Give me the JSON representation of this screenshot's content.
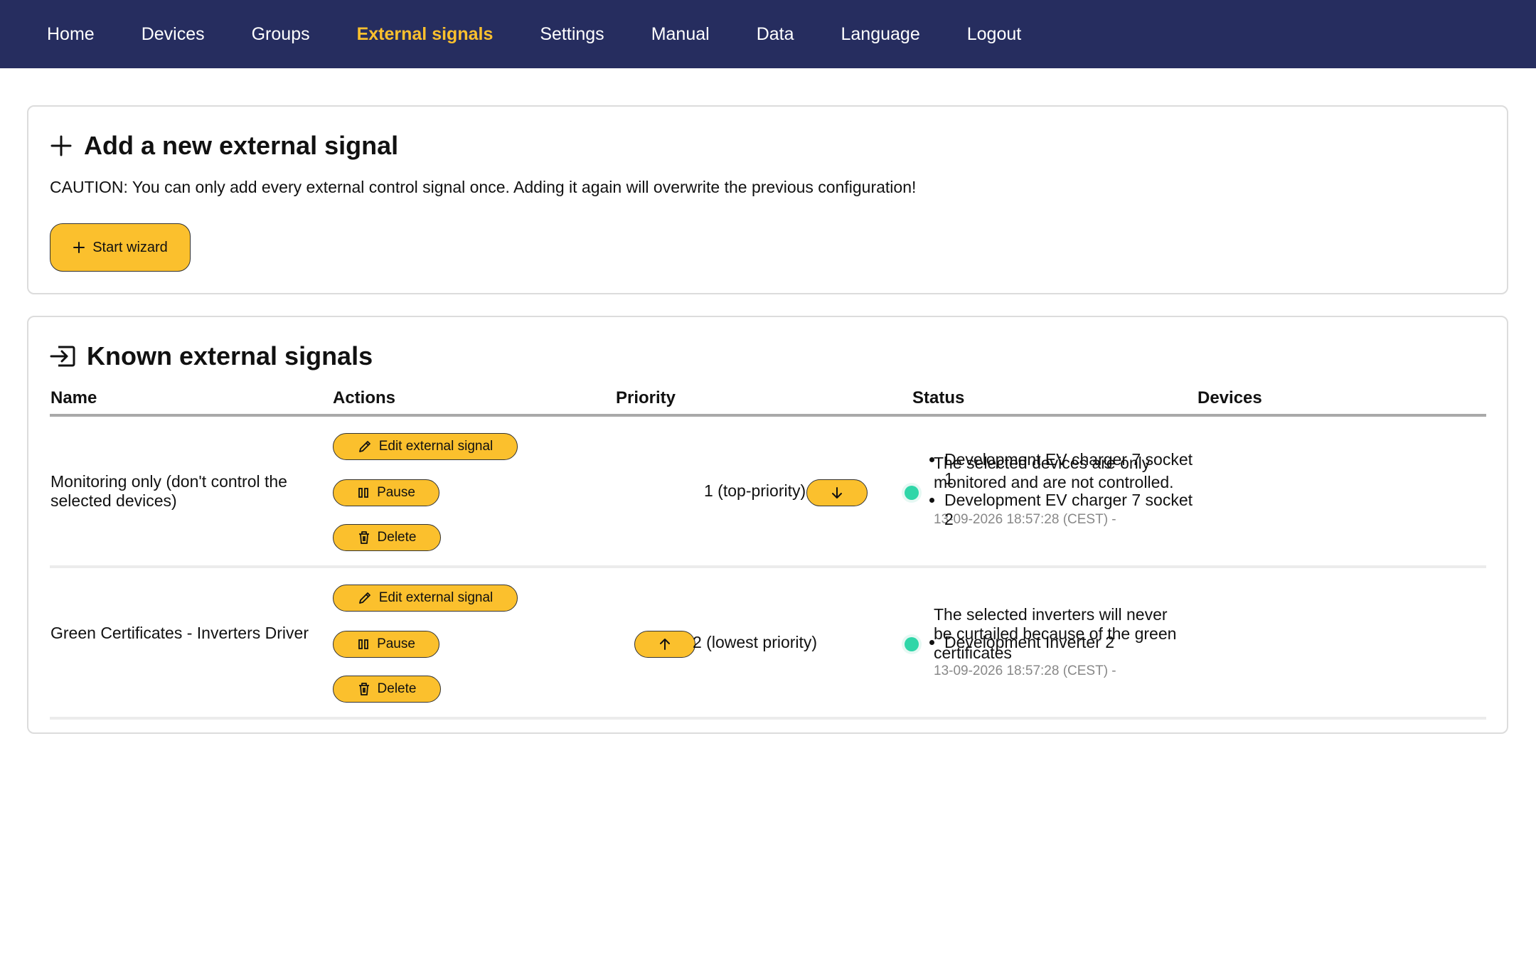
{
  "nav": {
    "items": [
      "Home",
      "Devices",
      "Groups",
      "External signals",
      "Settings",
      "Manual",
      "Data",
      "Language",
      "Logout"
    ],
    "active": "External signals"
  },
  "add_card": {
    "title": "Add a new external signal",
    "caution": "CAUTION: You can only add every external control signal once. Adding it again will overwrite the previous configuration!",
    "wizard_button": "Start wizard",
    "icon": "plus-icon"
  },
  "known_card": {
    "title": "Known external signals",
    "icon": "input-arrow-icon",
    "columns": {
      "name": "Name",
      "actions": "Actions",
      "priority": "Priority",
      "status": "Status",
      "devices": "Devices"
    },
    "rows": [
      {
        "name": "Monitoring only (don't control the selected devices)",
        "actions": {
          "edit": "Edit external signal",
          "pause": "Pause",
          "delete": "Delete"
        },
        "priority": "1 (top-priority)",
        "priority_move": "down",
        "status_text": "The selected devices are only monitored and are not controlled.",
        "status_time": "13-09-2026 18:57:28 (CEST) -",
        "devices": [
          "Development EV charger 7 socket 1",
          "Development EV charger 7 socket 2"
        ]
      },
      {
        "name": "Green Certificates - Inverters Driver",
        "actions": {
          "edit": "Edit external signal",
          "pause": "Pause",
          "delete": "Delete"
        },
        "priority": "2 (lowest priority)",
        "priority_move": "up",
        "status_text": "The selected inverters will never be curtailed because of the green certificates",
        "status_time": "13-09-2026 18:57:28 (CEST) -",
        "devices": [
          "Development Inverter 2"
        ]
      }
    ]
  },
  "colors": {
    "navbar": "#262d5f",
    "accent": "#fbc02d",
    "status_ok": "#2fd6a8"
  }
}
